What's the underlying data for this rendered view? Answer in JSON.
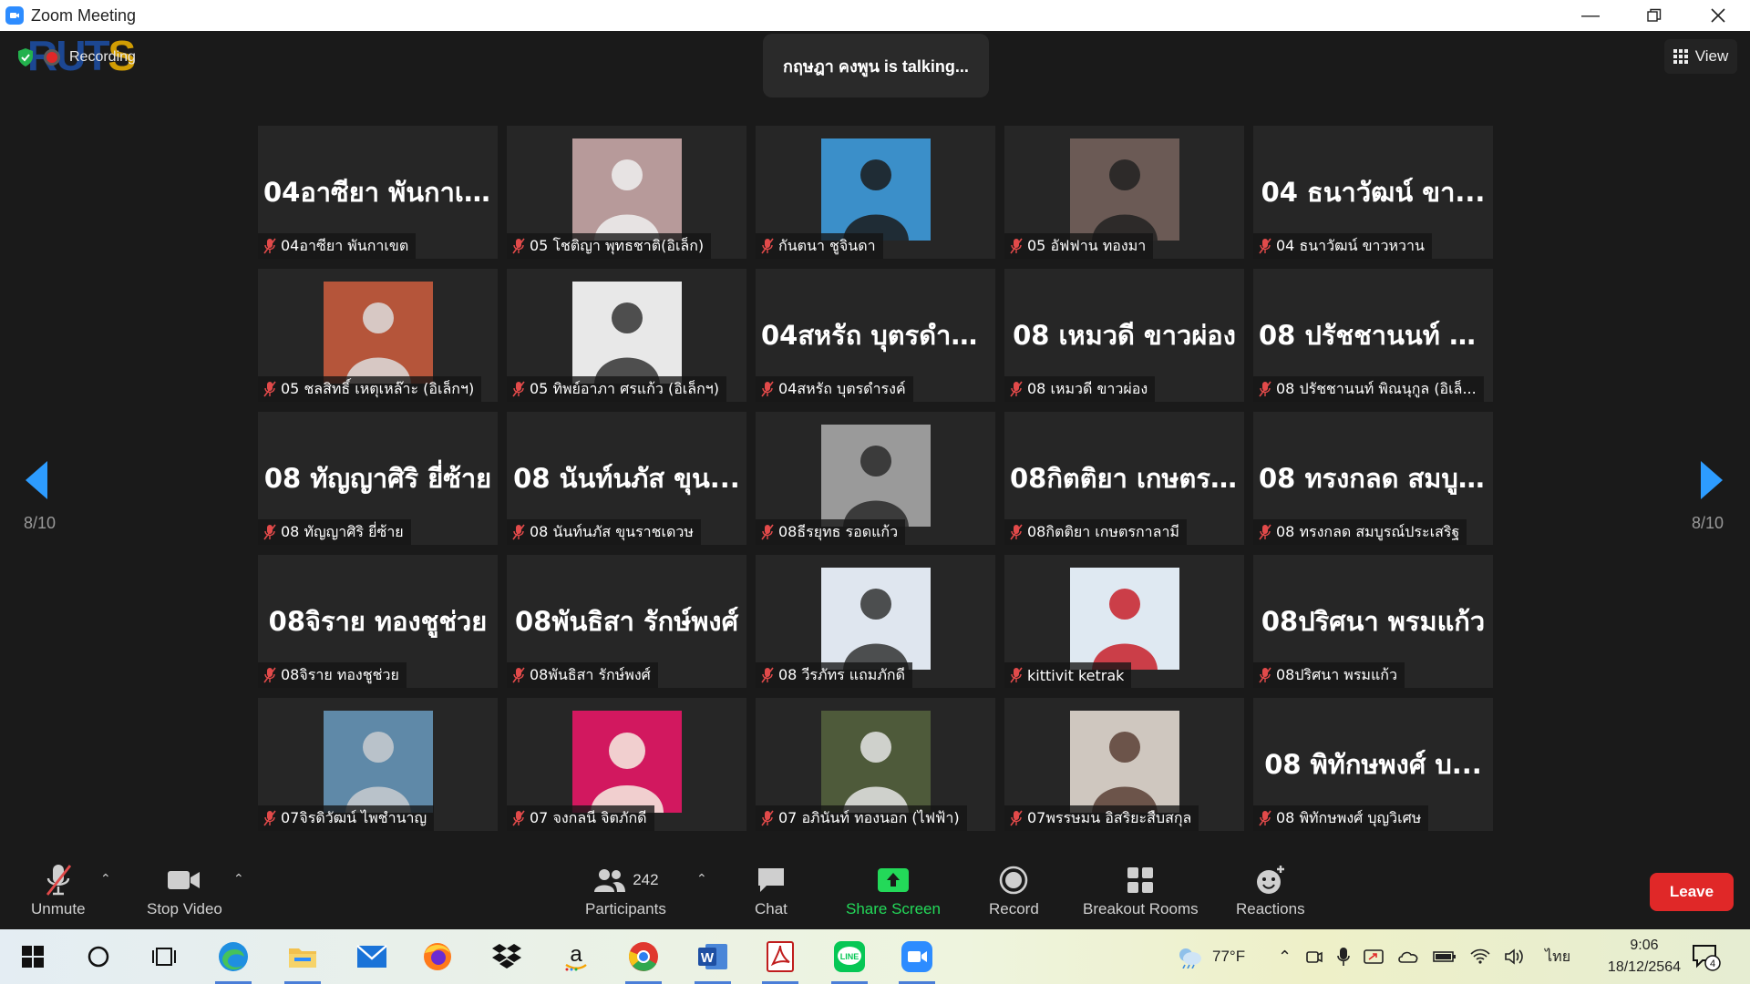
{
  "window": {
    "title": "Zoom Meeting"
  },
  "meeting": {
    "recording_label": "Recording",
    "logo_text": "RUTS",
    "talking_banner": "กฤษฎา คงพูน is talking...",
    "view_label": "View",
    "page_indicator": "8/10"
  },
  "tiles": [
    {
      "big": "04อาซียา พันกาเขต",
      "name": "04อาซียา พันกาเขต",
      "photo": false
    },
    {
      "big": "",
      "name": "05 โชติญา พุทธชาติ(อิเล็ก)",
      "photo": true,
      "bg": "#b79a9a",
      "fg": "#f0f0f0"
    },
    {
      "big": "",
      "name": "กันตนา ชูจินดา",
      "photo": true,
      "bg": "#3b8fc9",
      "fg": "#1b1b1b"
    },
    {
      "big": "",
      "name": "05 อัฟฟาน ทองมา",
      "photo": true,
      "bg": "#6b5a55",
      "fg": "#222"
    },
    {
      "big": "04 ธนาวัฒน์ ขา...",
      "name": "04 ธนาวัฒน์ ขาวหวาน",
      "photo": false
    },
    {
      "big": "",
      "name": "05 ชลสิทธิ์ เหตุเหล๊าะ (อิเล็กฯ)",
      "photo": true,
      "bg": "#b5553a",
      "fg": "#ddd"
    },
    {
      "big": "",
      "name": "05 ทิพย์อาภา ศรแก้ว (อิเล็กฯ)",
      "photo": true,
      "bg": "#e8e8e8",
      "fg": "#333"
    },
    {
      "big": "04สหรัถ บุตรดำร...",
      "name": "04สหรัถ บุตรดำรงค์",
      "photo": false
    },
    {
      "big": "08 เหมวดี ขาวผ่อง",
      "name": "08 เหมวดี ขาวผ่อง",
      "photo": false
    },
    {
      "big": "08 ปรัชชานนท์ พิ...",
      "name": "08 ปรัชชานนท์ พิณนุกูล (อิเล็...",
      "photo": false
    },
    {
      "big": "08 ทัญญาศิริ ยี่ซ้าย",
      "name": "08 ทัญญาศิริ ยี่ซ้าย",
      "photo": false
    },
    {
      "big": "08 นันท์นภัส ขุน...",
      "name": "08 นันท์นภัส ขุนราชเดวษ",
      "photo": false
    },
    {
      "big": "",
      "name": "08ธีรยุทธ รอดแก้ว",
      "photo": true,
      "bg": "#9a9a9a",
      "fg": "#2a2a2a"
    },
    {
      "big": "08กิตติยา เกษตร...",
      "name": "08กิตติยา เกษตรกาลามี",
      "photo": false
    },
    {
      "big": "08 ทรงกลด สมบู...",
      "name": "08 ทรงกลด สมบูรณ์ประเสริฐ",
      "photo": false
    },
    {
      "big": "08จิราย ทองชูช่วย",
      "name": "08จิราย ทองชูช่วย",
      "photo": false
    },
    {
      "big": "08พันธิสา รักษ์พงศ์",
      "name": "08พันธิสา รักษ์พงศ์",
      "photo": false
    },
    {
      "big": "",
      "name": "08 วีรภัทร แถมภักดี",
      "photo": true,
      "bg": "#dfe6ef",
      "fg": "#333"
    },
    {
      "big": "",
      "name": "kittivit ketrak",
      "photo": true,
      "bg": "#dfe9f2",
      "fg": "#c8202a"
    },
    {
      "big": "08ปริศนา พรมแก้ว",
      "name": "08ปริศนา พรมแก้ว",
      "photo": false
    },
    {
      "big": "",
      "name": "07จิรดิวัฒน์ ไพชำนาญ",
      "photo": true,
      "bg": "#5f89a8",
      "fg": "#c9ccd0"
    },
    {
      "big": "",
      "name": "07 จงกลนี จิตภักดี",
      "photo": true,
      "bg": "#d2185f",
      "fg": "#f1cfcf",
      "avatar": true
    },
    {
      "big": "",
      "name": "07 อภินันท์ ทองนอก (ไฟฟ้า)",
      "photo": true,
      "bg": "#4e5a3a",
      "fg": "#e6e6e6"
    },
    {
      "big": "",
      "name": "07พรรษมน อิสริยะสืบสกุล",
      "photo": true,
      "bg": "#cfc7bf",
      "fg": "#5a3f35"
    },
    {
      "big": "08 พิทักษพงศ์ บ...",
      "name": "08 พิทักษพงศ์ บุญวิเศษ",
      "photo": false
    }
  ],
  "toolbar": {
    "unmute": "Unmute",
    "stop_video": "Stop Video",
    "participants": "Participants",
    "participant_count": "242",
    "chat": "Chat",
    "share_screen": "Share Screen",
    "record": "Record",
    "breakout_rooms": "Breakout Rooms",
    "reactions": "Reactions",
    "leave": "Leave"
  },
  "taskbar": {
    "weather": "77°F",
    "language": "ไทย",
    "time": "9:06",
    "date": "18/12/2564",
    "notification_count": "4"
  },
  "colors": {
    "zoom_blue": "#2d8cff",
    "share_green": "#23d959",
    "leave_red": "#e02828",
    "mute_red": "#e24a4a"
  }
}
